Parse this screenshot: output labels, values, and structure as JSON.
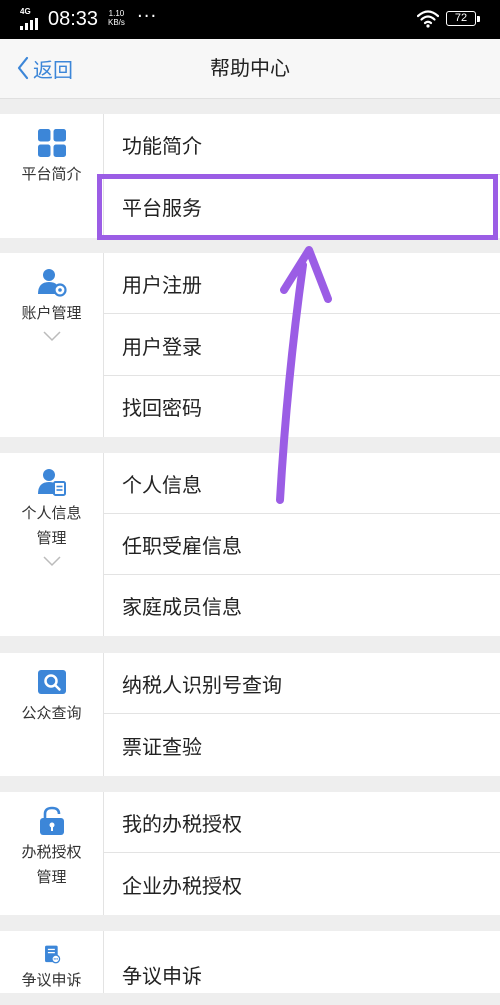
{
  "status_bar": {
    "network": "4G",
    "time": "08:33",
    "speed_value": "1.10",
    "speed_unit": "KB/s",
    "more": "···",
    "battery": "72"
  },
  "nav": {
    "back_label": "返回",
    "title": "帮助中心"
  },
  "sections": [
    {
      "category": "平台简介",
      "icon": "grid-icon",
      "items": [
        "功能简介",
        "平台服务"
      ]
    },
    {
      "category": "账户管理",
      "icon": "user-settings-icon",
      "items": [
        "用户注册",
        "用户登录",
        "找回密码"
      ]
    },
    {
      "category": "个人信息管理",
      "category_lines": [
        "个人信息",
        "管理"
      ],
      "icon": "user-card-icon",
      "items": [
        "个人信息",
        "任职受雇信息",
        "家庭成员信息"
      ]
    },
    {
      "category": "公众查询",
      "icon": "search-icon",
      "items": [
        "纳税人识别号查询",
        "票证查验"
      ]
    },
    {
      "category": "办税授权管理",
      "category_lines": [
        "办税授权",
        "管理"
      ],
      "icon": "lock-icon",
      "items": [
        "我的办税授权",
        "企业办税授权"
      ]
    },
    {
      "category": "争议申诉",
      "icon": "document-icon",
      "items": [
        "争议申诉"
      ]
    }
  ],
  "colors": {
    "accent_blue": "#3c86d8",
    "highlight_purple": "#9b5de5"
  }
}
